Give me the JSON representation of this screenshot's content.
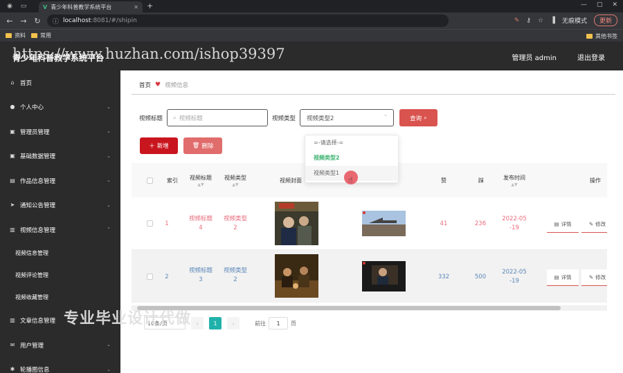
{
  "browser": {
    "tab_title": "青少年科普教学系统平台",
    "url_host": "localhost",
    "url_path": ":8081/#/shipin",
    "incognito_label": "无痕模式",
    "update_label": "更新",
    "bookmarks": [
      "资料",
      "常用"
    ],
    "bookmarks_right": "其他书签"
  },
  "header": {
    "site_title": "青少年科普教学系统平台",
    "watermark_url": "https://www.huzhan.com/ishop39397",
    "user_label": "管理员 admin",
    "logout_label": "退出登录"
  },
  "sidebar": {
    "items": [
      {
        "label": "首页",
        "icon": "home-icon"
      },
      {
        "label": "个人中心",
        "icon": "user-icon"
      },
      {
        "label": "管理员管理",
        "icon": "briefcase-icon"
      },
      {
        "label": "基础数据管理",
        "icon": "briefcase-icon"
      },
      {
        "label": "作品信息管理",
        "icon": "document-icon"
      },
      {
        "label": "通知公告管理",
        "icon": "send-icon"
      },
      {
        "label": "视频信息管理",
        "icon": "clipboard-icon"
      }
    ],
    "sub_items": [
      "视频信息管理",
      "视频评论管理",
      "视频收藏管理"
    ],
    "items_after": [
      {
        "label": "文章信息管理",
        "icon": "clipboard-icon"
      },
      {
        "label": "用户管理",
        "icon": "mail-icon"
      },
      {
        "label": "轮播图信息",
        "icon": "settings-icon"
      }
    ]
  },
  "breadcrumb": {
    "home": "首页",
    "current": "视频信息"
  },
  "filters": {
    "title_label": "视频标题",
    "title_placeholder": "视频标题",
    "type_label": "视频类型",
    "type_value": "视频类型2",
    "query_label": "查询"
  },
  "actions": {
    "add_label": "新增",
    "delete_label": "删除"
  },
  "dropdown": {
    "options": [
      "=-请选择-=",
      "视频类型2",
      "视频类型1"
    ]
  },
  "table": {
    "headers": [
      "索引",
      "视频标题",
      "视频类型",
      "视频封面",
      "赞",
      "踩",
      "发布时间",
      "操作"
    ],
    "rows": [
      {
        "index": "1",
        "title_l1": "视频标题",
        "title_l2": "4",
        "type_l1": "视频类型",
        "type_l2": "2",
        "likes": "41",
        "dislikes": "236",
        "date_l1": "2022-05",
        "date_l2": "-19"
      },
      {
        "index": "2",
        "title_l1": "视频标题",
        "title_l2": "3",
        "type_l1": "视频类型",
        "type_l2": "2",
        "likes": "332",
        "dislikes": "500",
        "date_l1": "2022-05",
        "date_l2": "-19"
      }
    ],
    "detail_label": "详情",
    "edit_label": "修改"
  },
  "pagination": {
    "size_label": "10条/页",
    "current_page": "1",
    "goto_label": "前往",
    "goto_value": "1",
    "page_suffix": "页"
  },
  "overlay": {
    "text": "专业毕业设计代做"
  },
  "colors": {
    "primary_red": "#c9151e",
    "accent_teal": "#20b2aa",
    "sidebar_bg": "#2b2b2b"
  }
}
